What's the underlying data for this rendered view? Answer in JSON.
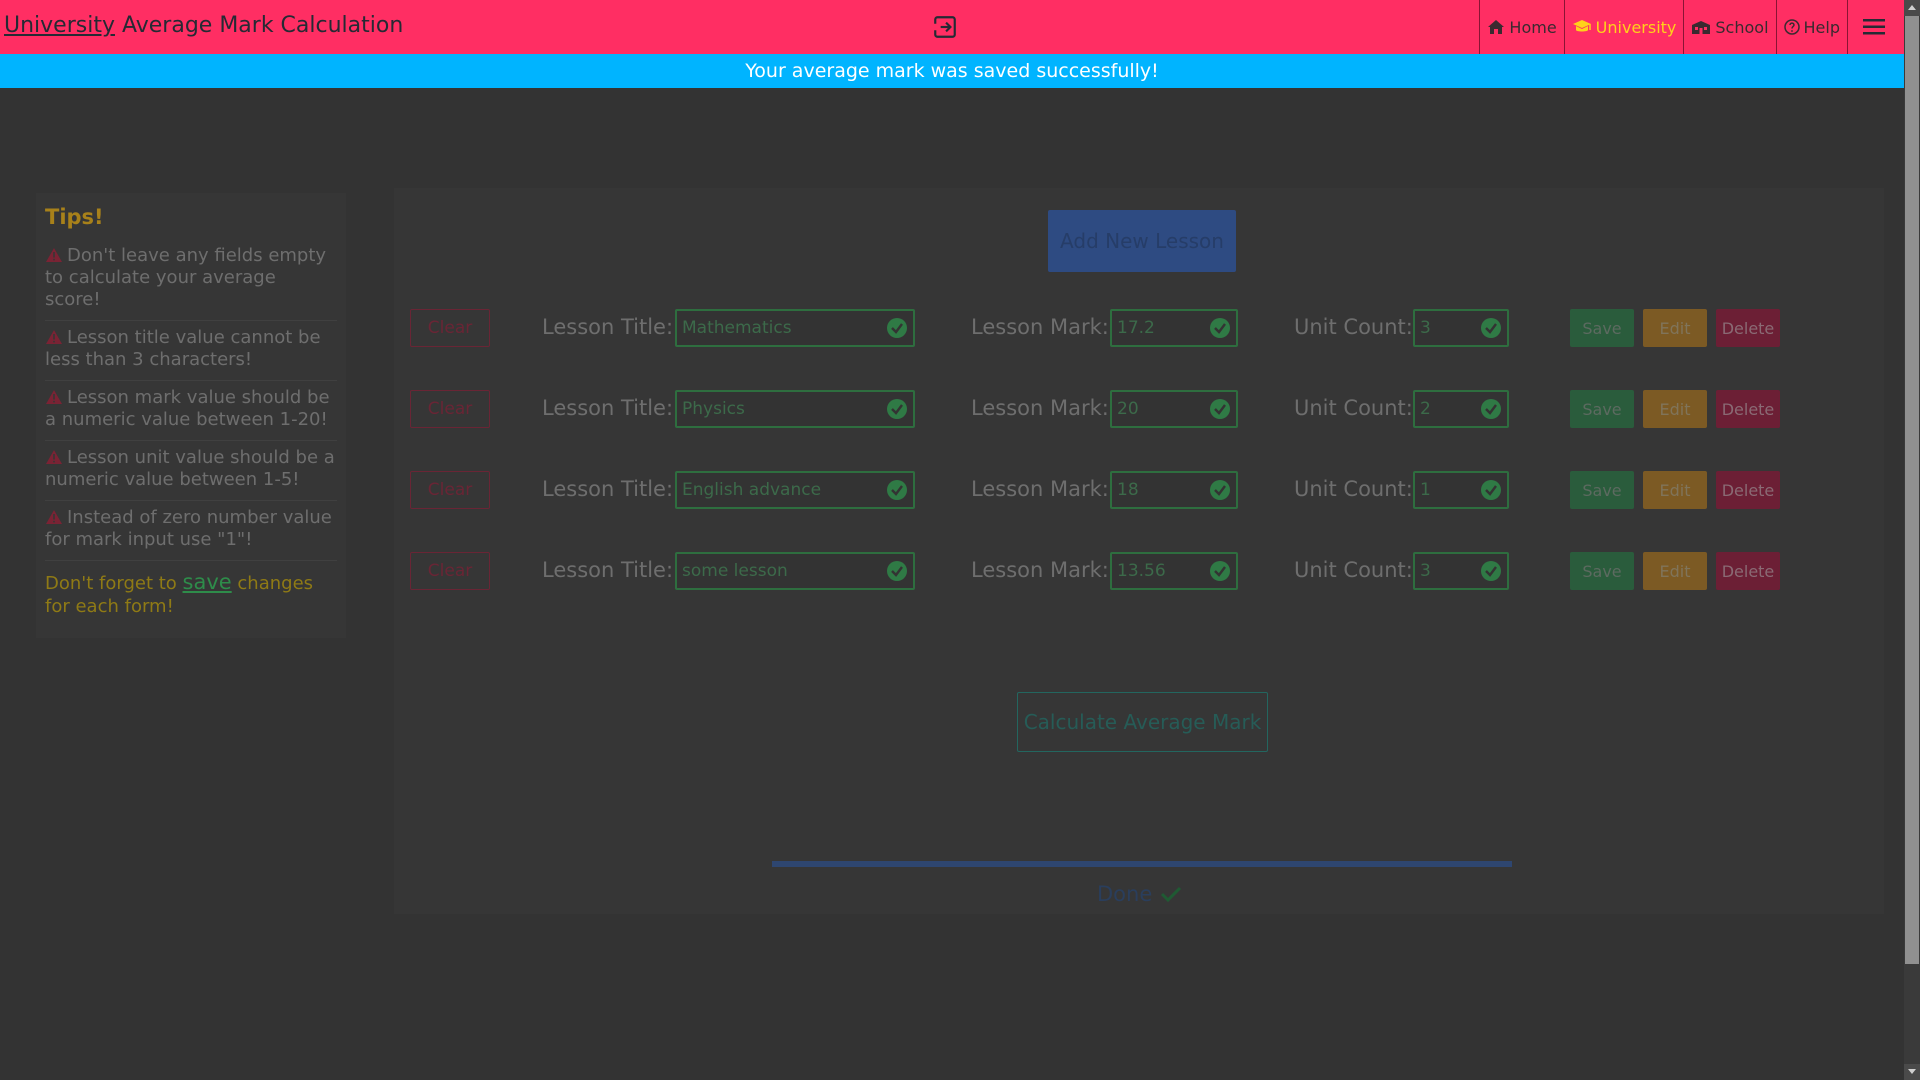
{
  "header": {
    "title_link": "University",
    "title_rest": " Average Mark Calculation",
    "nav": [
      {
        "label": "Home",
        "icon": "home-icon"
      },
      {
        "label": "University",
        "icon": "graduation-cap-icon",
        "active": true
      },
      {
        "label": "School",
        "icon": "school-icon"
      },
      {
        "label": "Help",
        "icon": "question-circle-icon"
      }
    ],
    "menu_icon": "hamburger-menu-icon",
    "exit_icon": "sign-in-icon"
  },
  "banner": {
    "message": "Your average mark was saved successfully!",
    "color": "#00b4ff"
  },
  "tips": {
    "title": "Tips!",
    "items": [
      "Don't leave any fields empty to calculate your average score!",
      "Lesson title value cannot be less than 3 characters!",
      "Lesson mark value should be a numeric value between 1-20!",
      "Lesson unit value should be a numeric value between 1-5!",
      "Instead of zero number value for mark input use \"1\"!"
    ],
    "note_before": "Don't forget to ",
    "note_link": "save",
    "note_after": " changes for each form!"
  },
  "main": {
    "add_button": "Add New Lesson",
    "labels": {
      "clear": "Clear",
      "title": "Lesson Title:",
      "mark": "Lesson Mark:",
      "units": "Unit Count:",
      "save": "Save",
      "edit": "Edit",
      "delete": "Delete"
    },
    "lessons": [
      {
        "title": "Mathematics",
        "mark": "17.2",
        "units": "3"
      },
      {
        "title": "Physics",
        "mark": "20",
        "units": "2"
      },
      {
        "title": "English advance",
        "mark": "18",
        "units": "1"
      },
      {
        "title": "some lesson",
        "mark": "13.56",
        "units": "3"
      }
    ],
    "calculate_button": "Calculate Average Mark",
    "progress": 1.0,
    "done_label": "Done"
  },
  "colors": {
    "header": "#ff2e63",
    "active_nav": "#ffd11a",
    "background": "#333333"
  }
}
